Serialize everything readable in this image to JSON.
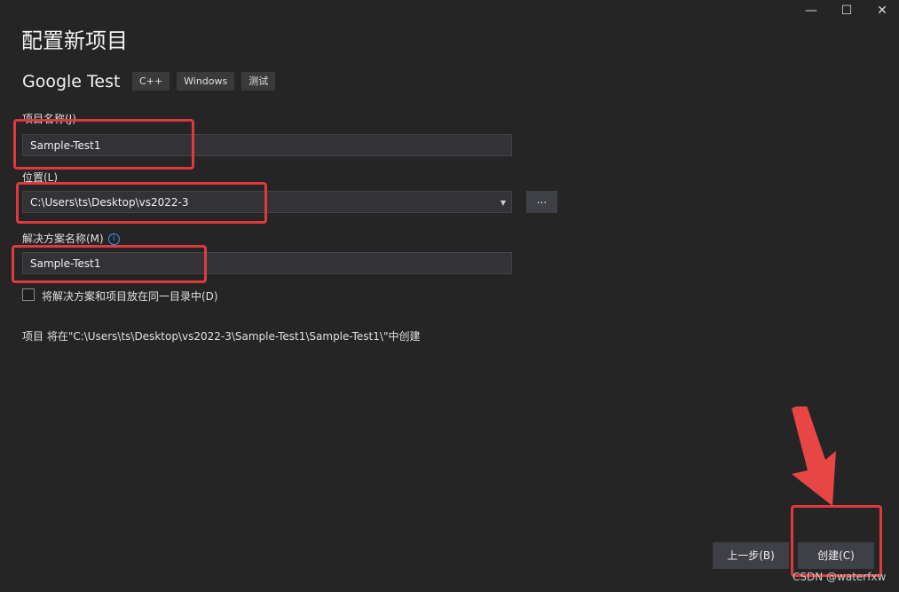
{
  "window": {
    "minimize_glyph": "—",
    "maximize_glyph": "☐",
    "close_glyph": "✕"
  },
  "title": "配置新项目",
  "template": {
    "name": "Google Test",
    "tags": [
      "C++",
      "Windows",
      "测试"
    ]
  },
  "form": {
    "project_name_label": "项目名称(J)",
    "project_name_value": "Sample-Test1",
    "location_label": "位置(L)",
    "location_value": "C:\\Users\\ts\\Desktop\\vs2022-3",
    "browse_label": "...",
    "solution_name_label": "解决方案名称(M)",
    "solution_name_value": "Sample-Test1",
    "same_dir_label": "将解决方案和项目放在同一目录中(D)",
    "same_dir_checked": false
  },
  "summary": "项目 将在\"C:\\Users\\ts\\Desktop\\vs2022-3\\Sample-Test1\\Sample-Test1\\\"中创建",
  "buttons": {
    "back": "上一步(B)",
    "create": "创建(C)"
  },
  "annotation_color": "#e0393b",
  "watermark": "CSDN @waterfxw"
}
